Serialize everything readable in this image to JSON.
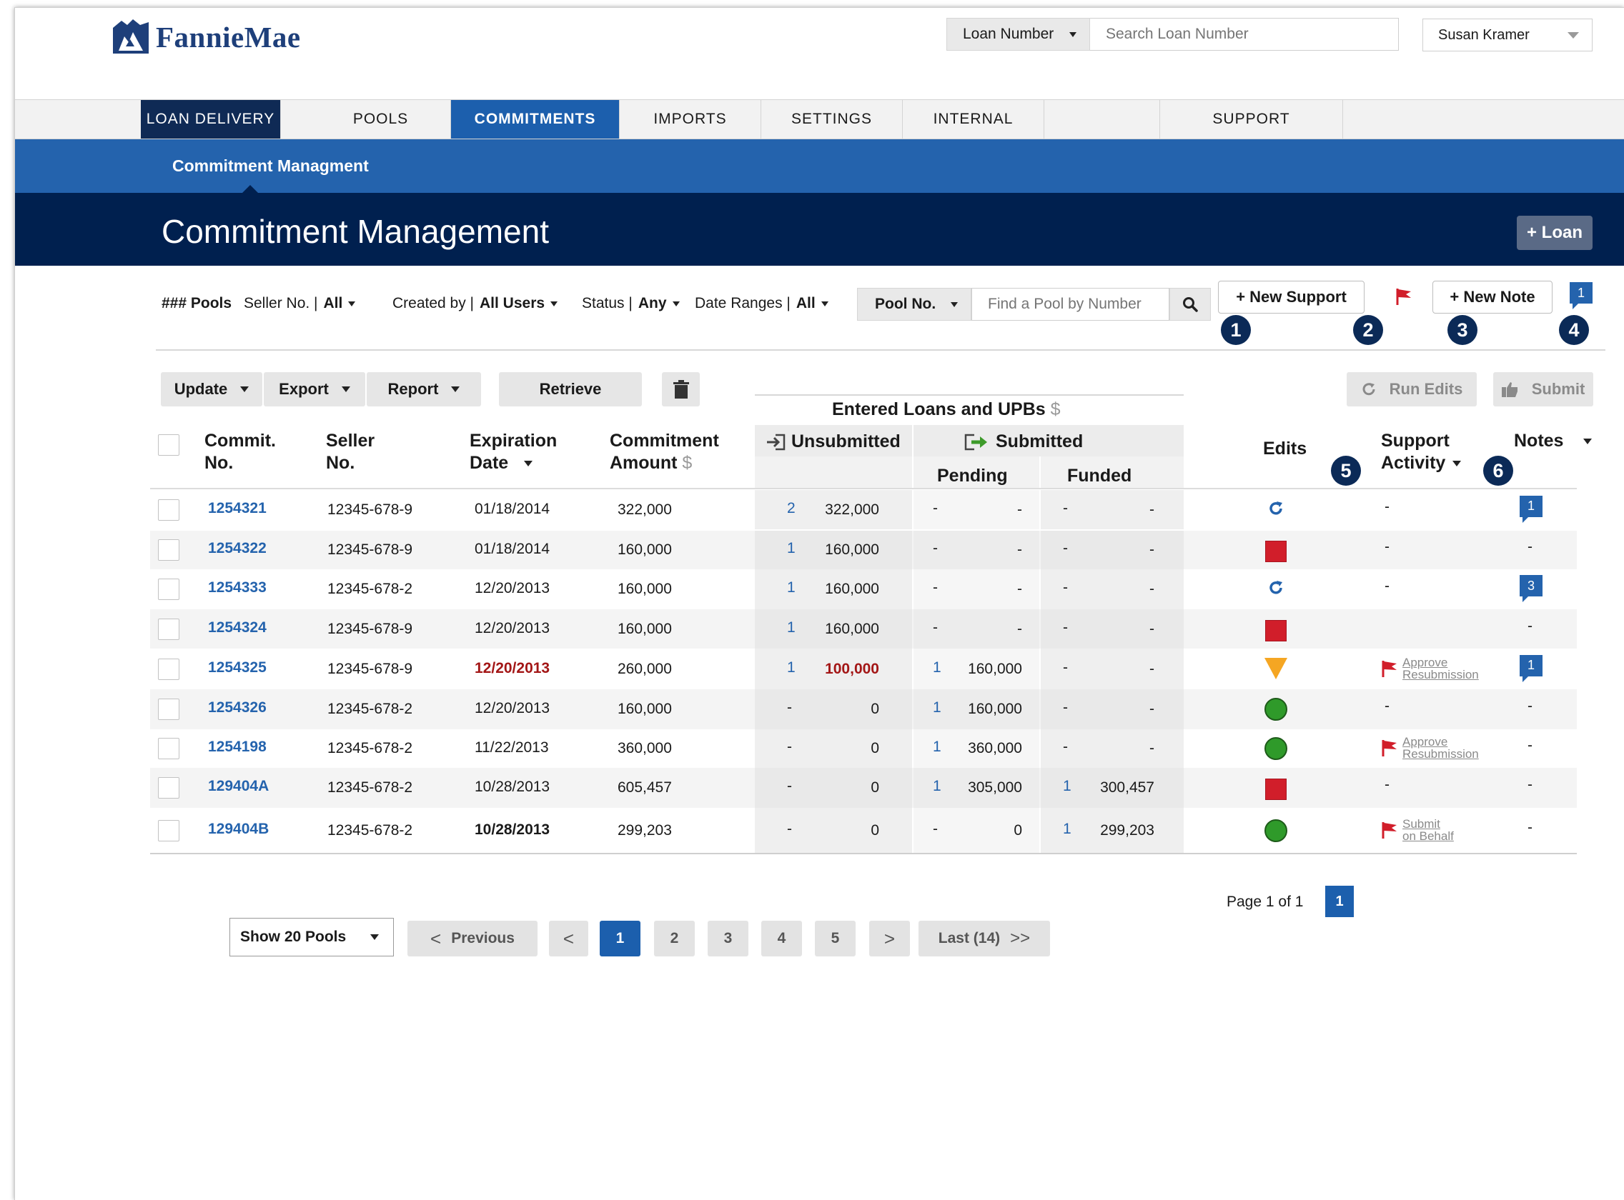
{
  "header": {
    "logo_text": "FannieMae",
    "search_type": "Loan Number",
    "search_placeholder": "Search Loan Number",
    "user_name": "Susan Kramer"
  },
  "nav": {
    "items": [
      "LOAN DELIVERY",
      "POOLS",
      "COMMITMENTS",
      "IMPORTS",
      "SETTINGS",
      "INTERNAL",
      "",
      "SUPPORT"
    ]
  },
  "subnav": {
    "title": "Commitment Managment"
  },
  "title": {
    "text": "Commitment Management",
    "add_loan": "+ Loan"
  },
  "filters": {
    "pools_label": "### Pools",
    "seller_label": "Seller No. |",
    "seller_value": "All",
    "created_label": "Created by |",
    "created_value": "All Users",
    "status_label": "Status |",
    "status_value": "Any",
    "date_label": "Date Ranges |",
    "date_value": "All",
    "pool_no": "Pool No.",
    "pool_placeholder": "Find a Pool by Number",
    "new_support": "+ New Support",
    "new_note": "+ New Note",
    "note_count": "1"
  },
  "markers": [
    "1",
    "2",
    "3",
    "4",
    "5",
    "6"
  ],
  "toolbar": {
    "update": "Update",
    "export": "Export",
    "report": "Report",
    "retrieve": "Retrieve",
    "run_edits": "Run Edits",
    "submit": "Submit"
  },
  "table": {
    "group_header": "Entered Loans and UPBs",
    "group_unit": "$",
    "headers": {
      "commit_1": "Commit.",
      "commit_2": "No.",
      "seller_1": "Seller",
      "seller_2": "No.",
      "exp_1": "Expiration",
      "exp_2": "Date",
      "amt_1": "Commitment",
      "amt_2": "Amount",
      "amt_unit": "$",
      "unsubmitted": "Unsubmitted",
      "submitted": "Submitted",
      "pending": "Pending",
      "funded": "Funded",
      "edits": "Edits",
      "support_1": "Support",
      "support_2": "Activity",
      "notes": "Notes"
    },
    "rows": [
      {
        "no": "1254321",
        "seller": "12345-678-9",
        "exp": "01/18/2014",
        "amount": "322,000",
        "u_count": "2",
        "u_amt": "322,000",
        "p_count": "-",
        "p_amt": "-",
        "f_count": "-",
        "f_amt": "-",
        "edit": "rerun",
        "support": "-",
        "support2": "",
        "note": "1"
      },
      {
        "no": "1254322",
        "seller": "12345-678-9",
        "exp": "01/18/2014",
        "amount": "160,000",
        "u_count": "1",
        "u_amt": "160,000",
        "p_count": "-",
        "p_amt": "-",
        "f_count": "-",
        "f_amt": "-",
        "edit": "error",
        "support": "-",
        "support2": "",
        "note": "-"
      },
      {
        "no": "1254333",
        "seller": "12345-678-2",
        "exp": "12/20/2013",
        "amount": "160,000",
        "u_count": "1",
        "u_amt": "160,000",
        "p_count": "-",
        "p_amt": "-",
        "f_count": "-",
        "f_amt": "-",
        "edit": "rerun",
        "support": "-",
        "support2": "",
        "note": "3"
      },
      {
        "no": "1254324",
        "seller": "12345-678-9",
        "exp": "12/20/2013",
        "amount": "160,000",
        "u_count": "1",
        "u_amt": "160,000",
        "p_count": "-",
        "p_amt": "-",
        "f_count": "-",
        "f_amt": "-",
        "edit": "error",
        "support": "",
        "support2": "",
        "note": "-"
      },
      {
        "no": "1254325",
        "seller": "12345-678-9",
        "exp": "12/20/2013",
        "amount": "260,000",
        "u_count": "1",
        "u_amt": "100,000",
        "p_count": "1",
        "p_amt": "160,000",
        "f_count": "-",
        "f_amt": "-",
        "edit": "warning",
        "support": "Approve",
        "support2": "Resubmission",
        "note": "1"
      },
      {
        "no": "1254326",
        "seller": "12345-678-2",
        "exp": "12/20/2013",
        "amount": "160,000",
        "u_count": "-",
        "u_amt": "0",
        "p_count": "1",
        "p_amt": "160,000",
        "f_count": "-",
        "f_amt": "-",
        "edit": "ok",
        "support": "-",
        "support2": "",
        "note": "-"
      },
      {
        "no": "1254198",
        "seller": "12345-678-2",
        "exp": "11/22/2013",
        "amount": "360,000",
        "u_count": "-",
        "u_amt": "0",
        "p_count": "1",
        "p_amt": "360,000",
        "f_count": "-",
        "f_amt": "-",
        "edit": "ok",
        "support": "Approve",
        "support2": "Resubmission",
        "note": "-"
      },
      {
        "no": "129404A",
        "seller": "12345-678-2",
        "exp": "10/28/2013",
        "amount": "605,457",
        "u_count": "-",
        "u_amt": "0",
        "p_count": "1",
        "p_amt": "305,000",
        "f_count": "1",
        "f_amt": "300,457",
        "edit": "error",
        "support": "-",
        "support2": "",
        "note": "-"
      },
      {
        "no": "129404B",
        "seller": "12345-678-2",
        "exp": "10/28/2013",
        "amount": "299,203",
        "u_count": "-",
        "u_amt": "0",
        "p_count": "-",
        "p_amt": "0",
        "f_count": "1",
        "f_amt": "299,203",
        "edit": "ok",
        "support": "Submit",
        "support2": "on Behalf",
        "note": "-"
      }
    ]
  },
  "pagination": {
    "page_info": "Page 1 of 1",
    "page_badge": "1",
    "show": "Show 20 Pools",
    "previous": "Previous",
    "prev_arrow": "<",
    "next_arrow": ">",
    "pages": [
      "1",
      "2",
      "3",
      "4",
      "5"
    ],
    "last": "Last (14)"
  },
  "colors": {
    "nav_dark": "#0f2a55",
    "accent_blue": "#2463ad",
    "title_bar": "#00204f",
    "error_red": "#d11e2a",
    "ok_green": "#2f9a2a",
    "warn_orange": "#f5a623"
  }
}
